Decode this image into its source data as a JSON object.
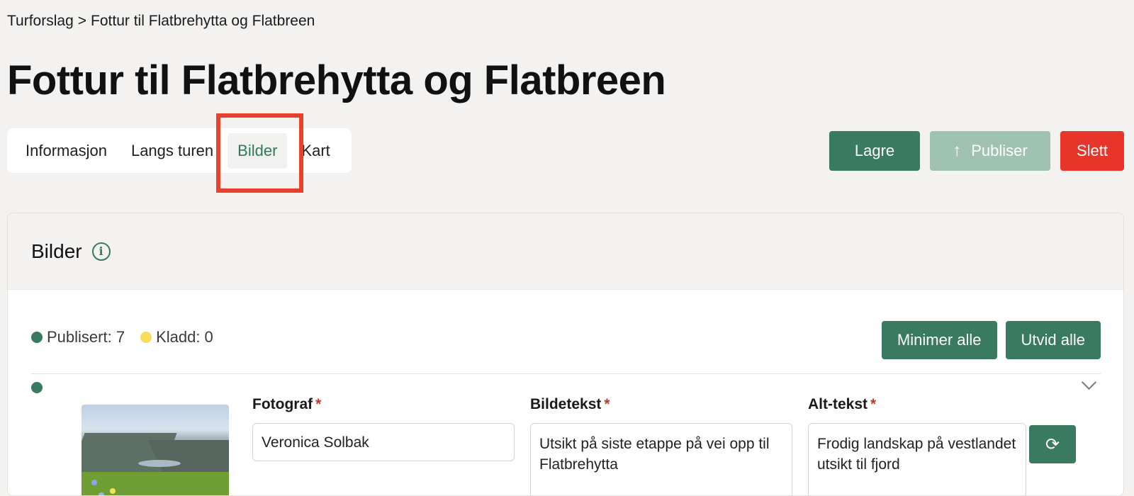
{
  "breadcrumb": {
    "parent": "Turforslag",
    "separator": ">",
    "current": "Fottur til Flatbrehytta og Flatbreen"
  },
  "page_title": "Fottur til Flatbrehytta og Flatbreen",
  "tabs": [
    {
      "label": "Informasjon",
      "active": false
    },
    {
      "label": "Langs turen",
      "active": false
    },
    {
      "label": "Bilder",
      "active": true
    },
    {
      "label": "Kart",
      "active": false
    }
  ],
  "actions": {
    "save": "Lagre",
    "publish": "Publiser",
    "delete": "Slett"
  },
  "colors": {
    "accent": "#3a7a61",
    "publish_disabled": "#9fc2b1",
    "danger": "#e8352b",
    "highlight": "#e8412c",
    "draft": "#f6dc5a"
  },
  "panel": {
    "title": "Bilder",
    "info_icon": "info-icon",
    "status": {
      "published": "Publisert: 7",
      "draft": "Kladd: 0"
    },
    "list_actions": {
      "minimize_all": "Minimer alle",
      "expand_all": "Utvid alle"
    },
    "item": {
      "photographer_label": "Fotograf",
      "photographer_value": "Veronica Solbak",
      "caption_label": "Bildetekst",
      "caption_value": "Utsikt på siste etappe på vei opp til Flatbrehytta",
      "alt_label": "Alt-tekst",
      "alt_value": "Frodig landskap på vestlandet utsikt til fjord",
      "required_mark": "*"
    }
  }
}
